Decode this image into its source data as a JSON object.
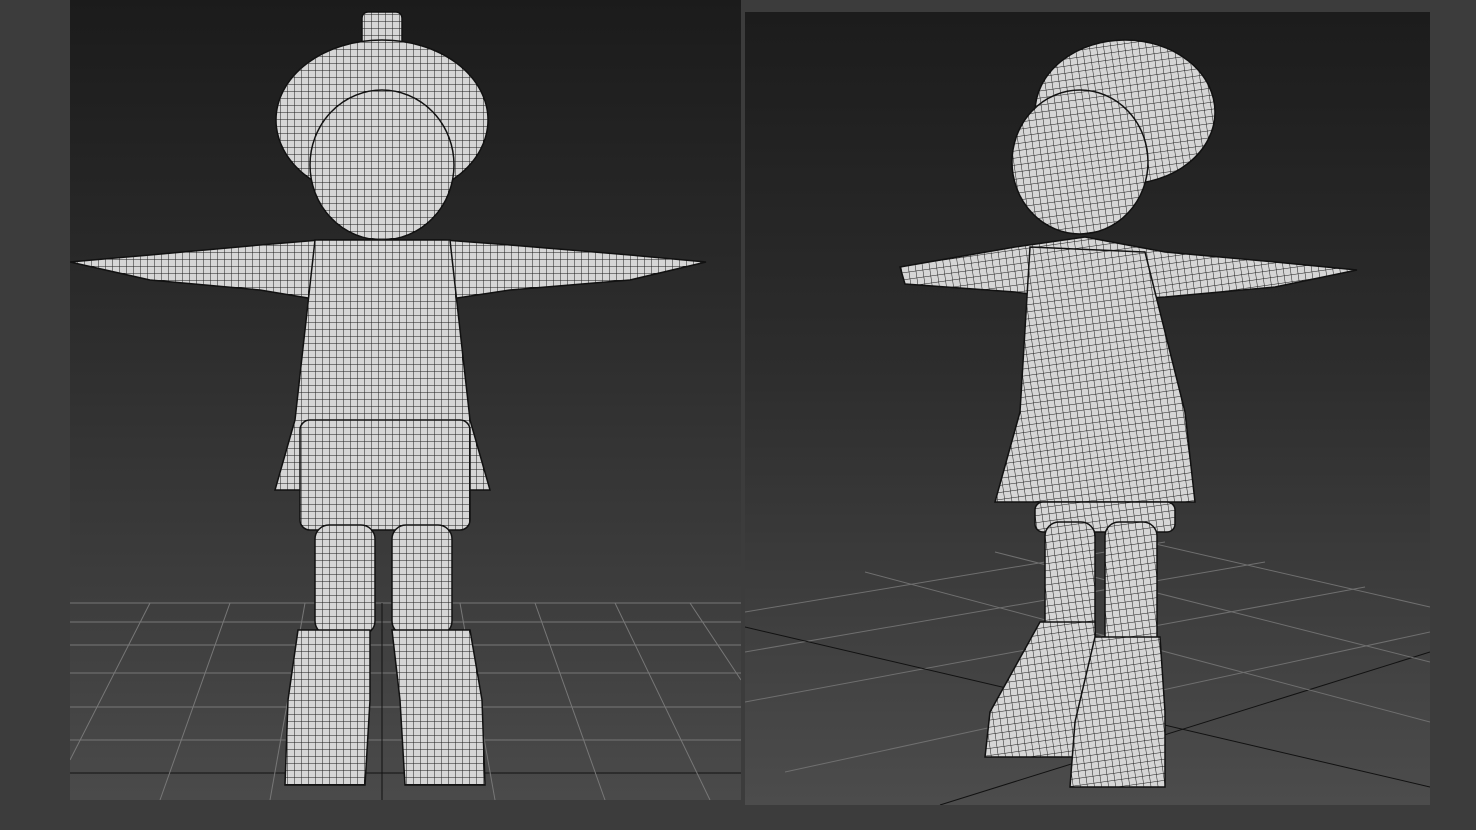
{
  "viewports": [
    {
      "view": "front",
      "shading": "wireframe-on-shaded"
    },
    {
      "view": "perspective",
      "shading": "wireframe-on-shaded"
    }
  ],
  "colors": {
    "background": "#3c3c3c",
    "mesh": "#d8d8d8",
    "wire": "#1a1a1a",
    "grid": "#6a6a6a"
  }
}
